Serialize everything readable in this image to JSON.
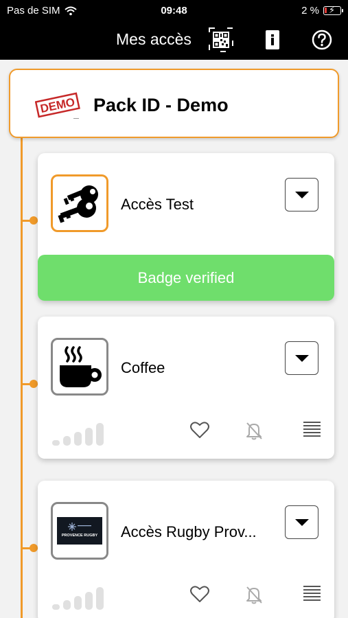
{
  "status_bar": {
    "carrier": "Pas de SIM",
    "time": "09:48",
    "battery": "2 %"
  },
  "header": {
    "title": "Mes accès",
    "buttons": [
      "qr-code-icon",
      "info-icon",
      "help-icon"
    ]
  },
  "pack": {
    "title": "Pack ID - Demo",
    "logo_text": "DEMO"
  },
  "accesses": [
    {
      "title": "Accès Test",
      "icon": "key-icon",
      "badge": "Badge verified"
    },
    {
      "title": "Coffee",
      "icon": "coffee-icon"
    },
    {
      "title": "Accès Rugby Prov...",
      "icon": "rugby-logo",
      "logo_text": "PROVENCE RUGBY"
    }
  ],
  "colors": {
    "accent": "#f09a2a",
    "badge": "#6fde6c",
    "header_bg": "#000000"
  }
}
